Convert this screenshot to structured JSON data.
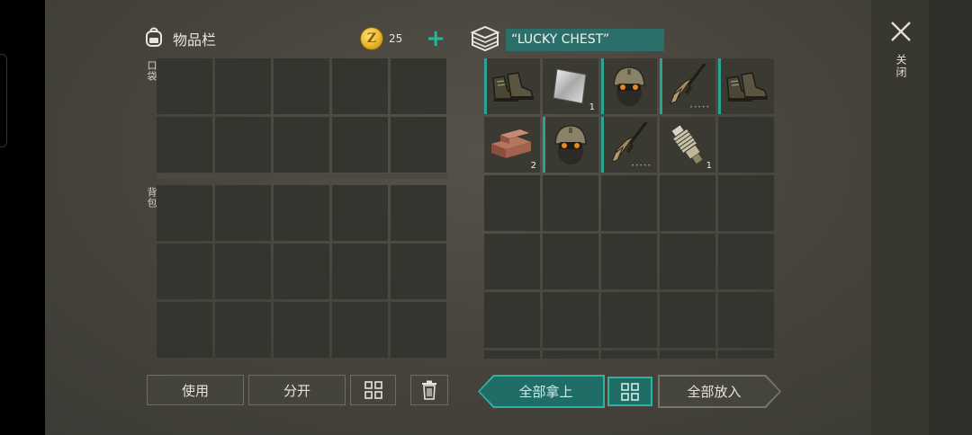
{
  "inventory": {
    "title": "物品栏",
    "pocket_label": "口袋",
    "backpack_label": "背包",
    "coins": "25",
    "coin_symbol": "Z",
    "add_symbol": "+",
    "pocket_slots": 10,
    "backpack_slots": 15
  },
  "chest": {
    "name": "“LUCKY CHEST”",
    "slots": [
      {
        "icon": "boots-icon",
        "qty": "",
        "dots": "",
        "marked": true
      },
      {
        "icon": "metal-sheet-icon",
        "qty": "1",
        "dots": "",
        "marked": false
      },
      {
        "icon": "tactical-helmet-icon",
        "qty": "",
        "dots": "",
        "marked": true
      },
      {
        "icon": "assault-rifle-icon",
        "qty": "",
        "dots": "•••••",
        "marked": true
      },
      {
        "icon": "boots-icon",
        "qty": "",
        "dots": "",
        "marked": true
      },
      {
        "icon": "bricks-icon",
        "qty": "2",
        "dots": "",
        "marked": false
      },
      {
        "icon": "tactical-helmet-icon",
        "qty": "",
        "dots": "",
        "marked": true
      },
      {
        "icon": "assault-rifle-icon",
        "qty": "",
        "dots": "•••••",
        "marked": true
      },
      {
        "icon": "spring-part-icon",
        "qty": "1",
        "dots": "",
        "marked": false
      }
    ],
    "total_slots": 30
  },
  "buttons": {
    "use": "使用",
    "split": "分开",
    "take_all": "全部拿上",
    "put_all": "全部放入"
  },
  "close_label": "关闭",
  "colors": {
    "accent": "#2cb3a3",
    "chest_name_bg": "#2c6f6a",
    "coin": "#e9b52b"
  }
}
